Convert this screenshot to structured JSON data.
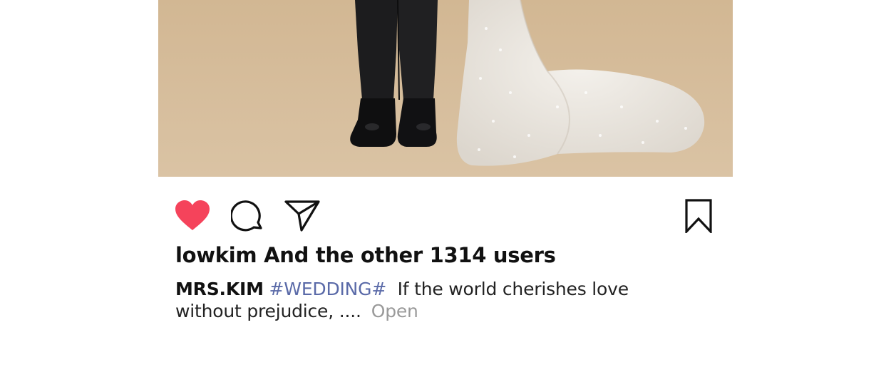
{
  "post": {
    "image_alt": "groom in black suit and bride in sequined gown",
    "likes_text": "lowkim And the other 1314 users",
    "caption": {
      "username": "MRS.KIM",
      "hashtag": "#WEDDING#",
      "text": "If the world cherishes love without prejudice, ....",
      "more_label": "Open"
    }
  },
  "icons": {
    "like": "heart-icon",
    "comment": "comment-bubble-icon",
    "share": "paper-plane-icon",
    "save": "bookmark-icon"
  },
  "colors": {
    "like_active": "#f5435b",
    "hashtag": "#5a6aa8",
    "muted": "#9a9a9a",
    "photo_background": "#d6bc9c"
  }
}
